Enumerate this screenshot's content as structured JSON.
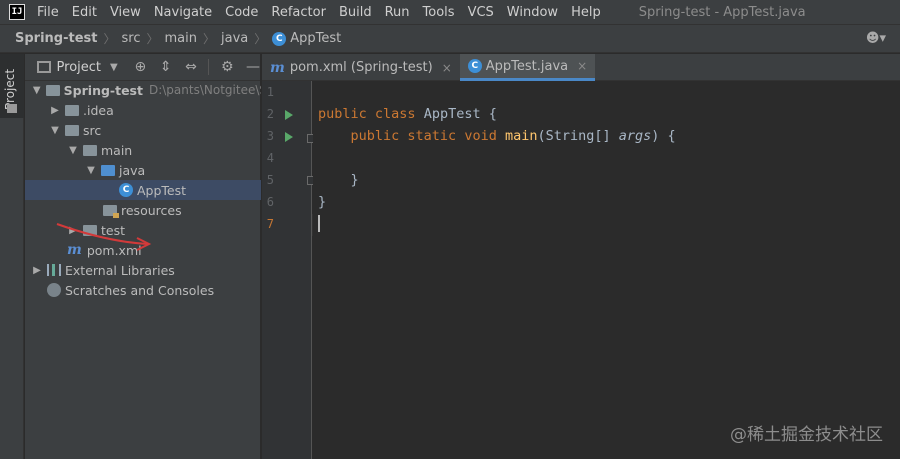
{
  "menubar": {
    "logo": "IJ",
    "items": [
      "File",
      "Edit",
      "View",
      "Navigate",
      "Code",
      "Refactor",
      "Build",
      "Run",
      "Tools",
      "VCS",
      "Window",
      "Help"
    ],
    "window_title": "Spring-test - AppTest.java"
  },
  "navbar": {
    "crumbs": [
      "Spring-test",
      "src",
      "main",
      "java",
      "AppTest"
    ],
    "user_icon": "user-icon"
  },
  "left_stripe": {
    "label": "Project"
  },
  "project_panel": {
    "title": "Project",
    "tree": [
      {
        "label": "Spring-test",
        "path": "D:\\pants\\Notgitee\\S",
        "arrow": "open"
      },
      {
        "label": ".idea",
        "arrow": "closed"
      },
      {
        "label": "src",
        "arrow": "open"
      },
      {
        "label": "main",
        "arrow": "open"
      },
      {
        "label": "java",
        "arrow": "open"
      },
      {
        "label": "AppTest",
        "arrow": "none"
      },
      {
        "label": "resources",
        "arrow": "none"
      },
      {
        "label": "test",
        "arrow": "closed"
      },
      {
        "label": "pom.xml",
        "arrow": "none"
      },
      {
        "label": "External Libraries",
        "arrow": "closed"
      },
      {
        "label": "Scratches and Consoles",
        "arrow": "none"
      }
    ]
  },
  "editor": {
    "tabs": [
      {
        "label": "pom.xml (Spring-test)",
        "close": "×",
        "active": false
      },
      {
        "label": "AppTest.java",
        "close": "×",
        "active": true
      }
    ],
    "line_numbers": [
      "1",
      "2",
      "3",
      "4",
      "5",
      "6",
      "7"
    ],
    "code": {
      "l2_kw1": "public ",
      "l2_kw2": "class ",
      "l2_name": "AppTest ",
      "l2_brace": "{",
      "l3_indent": "    ",
      "l3_kw1": "public ",
      "l3_kw2": "static ",
      "l3_kw3": "void ",
      "l3_fn": "main",
      "l3_open": "(String[] ",
      "l3_param": "args",
      "l3_close": ") {",
      "l5": "    }",
      "l6": "}"
    }
  },
  "watermark": "@稀土掘金技术社区",
  "colors": {
    "background": "#2b2b2b",
    "panel": "#3c3f41",
    "keyword": "#cc7832",
    "function": "#ffc66d",
    "run": "#59a869",
    "selection": "#3d4b64"
  }
}
